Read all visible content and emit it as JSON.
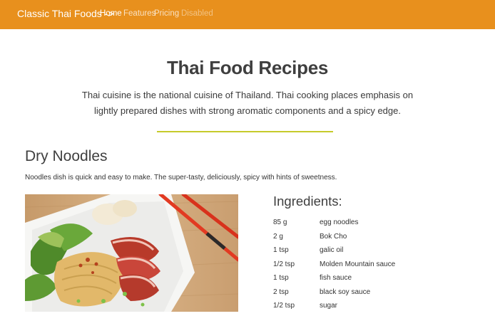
{
  "navbar": {
    "brand": "Classic Thai Foods ->",
    "links": [
      {
        "label": "Home"
      },
      {
        "label": "Features"
      },
      {
        "label": "Pricing"
      },
      {
        "label": "Disabled"
      }
    ],
    "color": "#e8901d"
  },
  "hero": {
    "title": "Thai Food Recipes",
    "description": "Thai cuisine is the national cuisine of Thailand. Thai cooking places emphasis on lightly prepared dishes with strong aromatic components and a spicy edge.",
    "divider_color": "#c6cb2a"
  },
  "recipe": {
    "title": "Dry Noodles",
    "description": "Noodles dish is quick and easy to make. The super-tasty, deliciously, spicy with hints of sweetness.",
    "ingredients_title": "Ingredients:",
    "ingredients": [
      {
        "qty": "85 g",
        "name": "egg noodles"
      },
      {
        "qty": "2 g",
        "name": "Bok Cho"
      },
      {
        "qty": "1 tsp",
        "name": "galic oil"
      },
      {
        "qty": "1/2 tsp",
        "name": "Molden Mountain sauce"
      },
      {
        "qty": "1 tsp",
        "name": "fish sauce"
      },
      {
        "qty": "2 tsp",
        "name": "black soy sauce"
      },
      {
        "qty": "1/2 tsp",
        "name": "sugar"
      }
    ]
  }
}
